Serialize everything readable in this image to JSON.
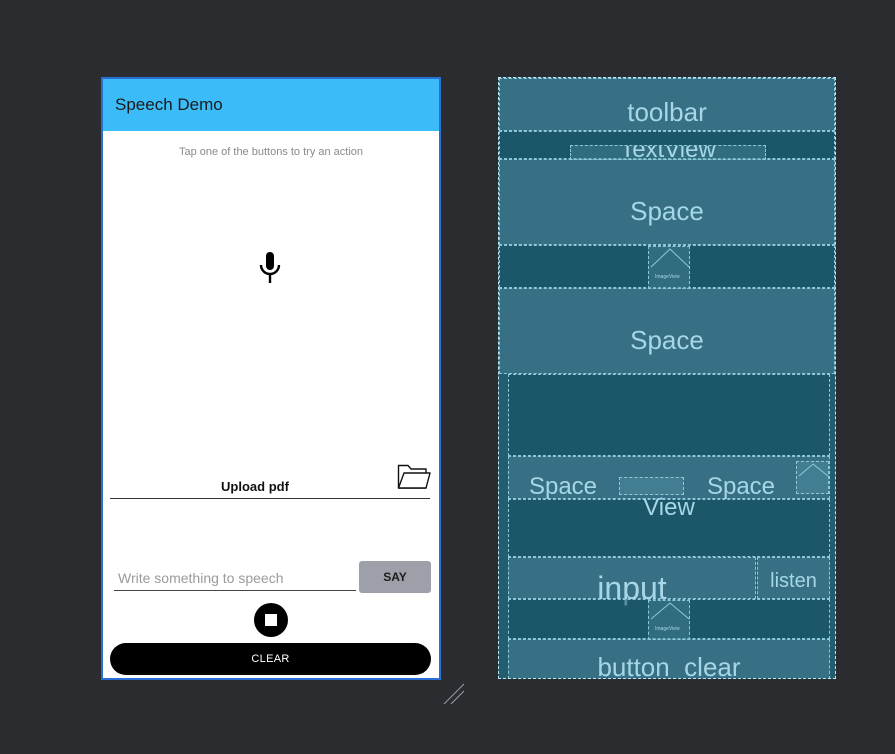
{
  "phone": {
    "toolbar_title": "Speech Demo",
    "hint": "Tap one of the buttons to try an action",
    "upload_label": "Upload pdf",
    "input_placeholder": "Write something to speech",
    "say_label": "SAY",
    "clear_label": "CLEAR",
    "colors": {
      "toolbar": "#3bbcf8",
      "say_button": "#9da0a8",
      "clear_button": "#000000"
    },
    "icons": {
      "mic": "mic-icon",
      "folder": "folder-icon",
      "stop": "stop-icon"
    }
  },
  "blueprint": {
    "toolbar": "toolbar",
    "textview": "TextView",
    "space_top": "Space",
    "space_middle": "Space",
    "space_left": "Space",
    "space_right": "Space",
    "view": "View",
    "input": "input",
    "listen": "listen",
    "button_clear": "button_clear",
    "imageview": "ImageView"
  }
}
